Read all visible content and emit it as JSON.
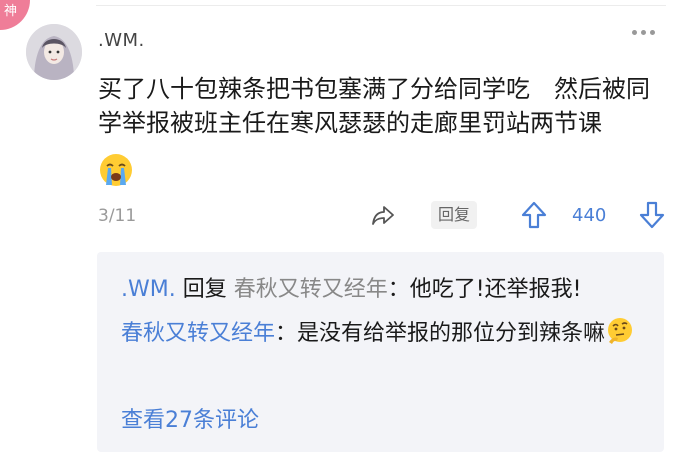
{
  "badge": {
    "label": "神"
  },
  "comment": {
    "username": ".WM.",
    "text": "买了八十包辣条把书包塞满了分给同学吃　然后被同学举报被班主任在寒风瑟瑟的走廊里罚站两节课",
    "emoji": "crying-face-emoji",
    "page": "3/11",
    "reply_button": "回复",
    "votes": "440"
  },
  "replies": {
    "items": [
      {
        "author": ".WM.",
        "reply_word": "回复",
        "target": "春秋又转又经年",
        "colon": "：",
        "text": "他吃了!还举报我!"
      },
      {
        "author": "春秋又转又经年",
        "colon": "：",
        "text": "是没有给举报的那位分到辣条嘛",
        "emoji": "thinking-face-emoji"
      }
    ],
    "view_more": "查看27条评论"
  },
  "colors": {
    "badge": "#ef7d98",
    "link": "#4a7fd6",
    "reply_bg": "#f3f4f8"
  }
}
